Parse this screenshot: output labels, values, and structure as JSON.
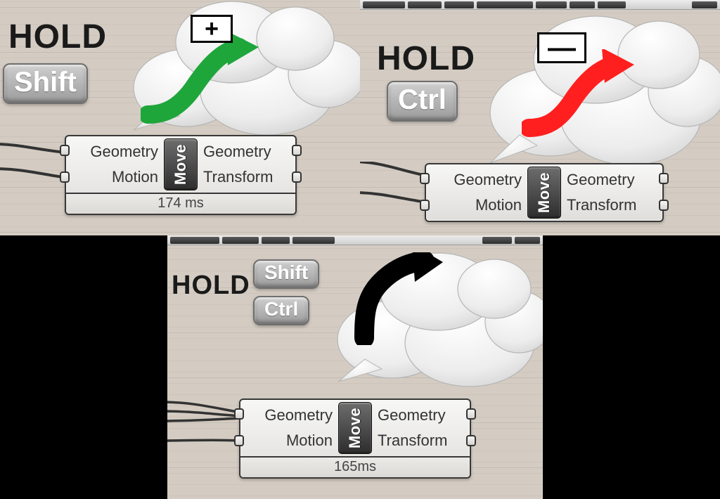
{
  "panels": {
    "top_left": {
      "hold": "HOLD",
      "key": "Shift",
      "op_symbol": "+",
      "arrow_color": "#1fa63b",
      "node": {
        "name": "Move",
        "in1": "Geometry",
        "in2": "Motion",
        "out1": "Geometry",
        "out2": "Transform",
        "timing": "174 ms"
      }
    },
    "top_right": {
      "hold": "HOLD",
      "key": "Ctrl",
      "op_symbol": "—",
      "arrow_color": "#ff1f1f",
      "node": {
        "name": "Move",
        "in1": "Geometry",
        "in2": "Motion",
        "out1": "Geometry",
        "out2": "Transform"
      }
    },
    "bottom": {
      "hold": "HOLD",
      "key1": "Shift",
      "key2": "Ctrl",
      "arrow_color": "#000000",
      "node": {
        "name": "Move",
        "in1": "Geometry",
        "in2": "Motion",
        "out1": "Geometry",
        "out2": "Transform",
        "timing": "165ms"
      }
    }
  }
}
